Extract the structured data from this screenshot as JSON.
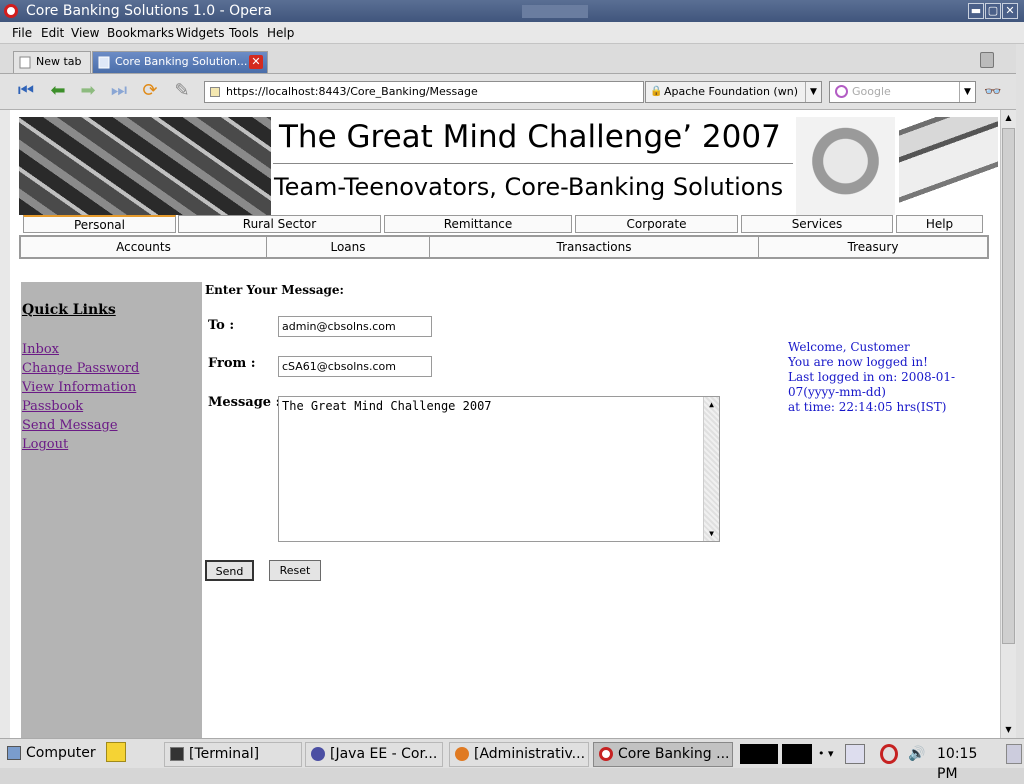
{
  "window": {
    "title": "Core Banking Solutions 1.0 - Opera",
    "min": "▬",
    "max": "▢",
    "close": "✕"
  },
  "menu": [
    "File",
    "Edit",
    "View",
    "Bookmarks",
    "Widgets",
    "Tools",
    "Help"
  ],
  "tabs": {
    "new_tab": "New tab",
    "active": "Core Banking Solution...",
    "close": "✕"
  },
  "nav": {
    "url": "https://localhost:8443/Core_Banking/Message",
    "cert": "Apache Foundation (wn)",
    "search_placeholder": "Google",
    "dd": "▼"
  },
  "banner": {
    "title": "The Great Mind Challenge’ 2007",
    "subtitle": "Team-Teenovators, Core-Banking Solutions"
  },
  "main_tabs": [
    "Personal",
    "Rural Sector",
    "Remittance",
    "Corporate",
    "Services",
    "Help"
  ],
  "sub_tabs": [
    "Accounts",
    "Loans",
    "Transactions",
    "Treasury"
  ],
  "sidebar": {
    "heading": "Quick Links",
    "links": [
      "Inbox",
      "Change Password",
      "View Information",
      "Passbook",
      "Send Message",
      "Logout"
    ]
  },
  "form": {
    "heading": "Enter Your Message:",
    "to_label": "To :",
    "to_value": "admin@cbsolns.com",
    "from_label": "From :",
    "from_value": "cSA61@cbsolns.com",
    "message_label": "Message :",
    "message_value": "The Great Mind Challenge 2007",
    "send": "Send",
    "reset": "Reset"
  },
  "welcome": [
    "Welcome, Customer",
    "You are now logged in!",
    "Last logged in on: 2008-01-07(yyyy-mm-dd)",
    "at time: 22:14:05 hrs(IST)"
  ],
  "taskbar": {
    "computer": "Computer",
    "tasks": [
      "[Terminal]",
      "[Java EE - Cor...",
      "[Administrativ...",
      "Core Banking ..."
    ],
    "clock": "10:15 PM"
  }
}
